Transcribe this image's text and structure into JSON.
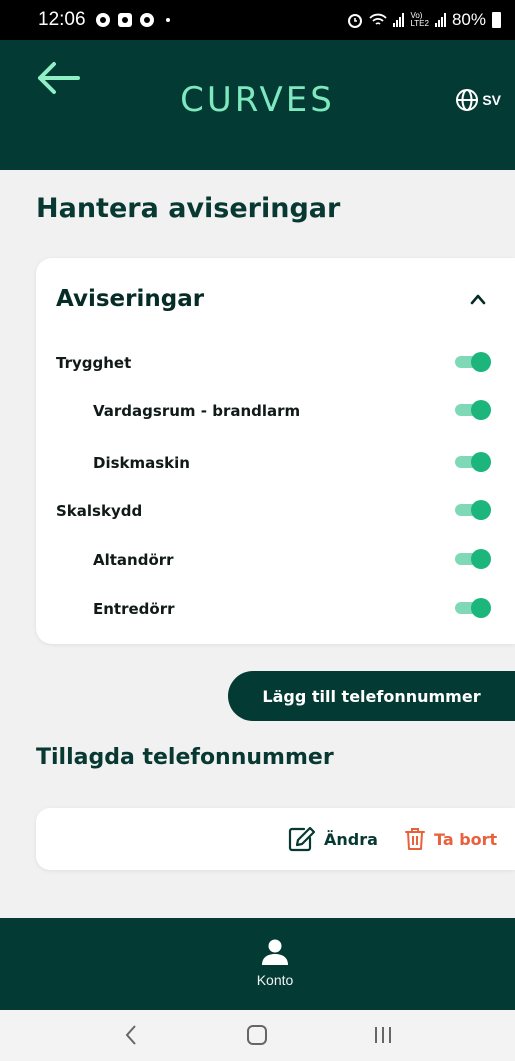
{
  "status_bar": {
    "time": "12:06",
    "battery": "80%"
  },
  "header": {
    "brand": "CURVES",
    "language": "SV",
    "back_icon": "arrow-left-icon",
    "language_icon": "globe-icon"
  },
  "page_title": "Hantera aviseringar",
  "notifications": {
    "title": "Aviseringar",
    "collapse_icon": "chevron-up-icon",
    "items": [
      {
        "label": "Trygghet",
        "level": 0,
        "enabled": true
      },
      {
        "label": "Vardagsrum - brandlarm",
        "level": 1,
        "enabled": true
      },
      {
        "label": "Diskmaskin",
        "level": 1,
        "enabled": true
      },
      {
        "label": "Skalskydd",
        "level": 0,
        "enabled": true
      },
      {
        "label": "Altandörr",
        "level": 1,
        "enabled": true
      },
      {
        "label": "Entredörr",
        "level": 1,
        "enabled": true
      }
    ]
  },
  "add_phone_button": "Lägg till telefonnummer",
  "phones": {
    "title": "Tillagda telefonnummer",
    "edit_label": "Ändra",
    "delete_label": "Ta bort"
  },
  "bottom_nav": {
    "account_label": "Konto",
    "account_icon": "person-icon"
  },
  "colors": {
    "primary": "#033a33",
    "brand": "#7ee8bf",
    "toggle_on": "#1cb57c",
    "toggle_track": "#7fd9b6",
    "delete": "#e8613c",
    "background": "#f1f1f1"
  }
}
